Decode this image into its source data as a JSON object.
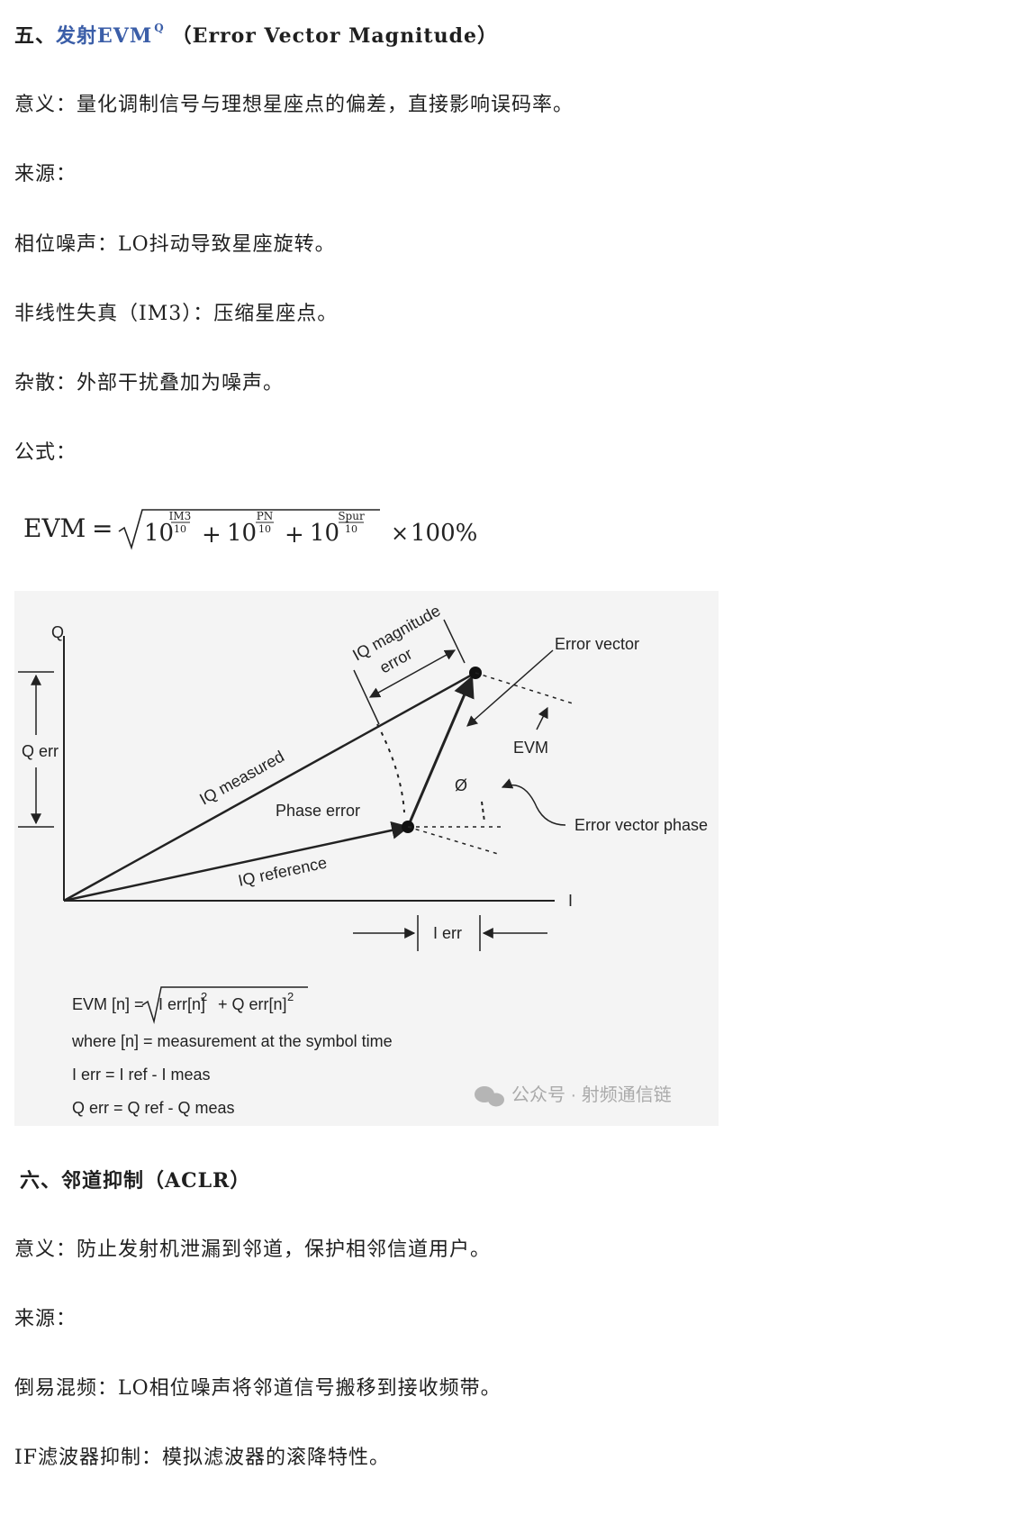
{
  "section5": {
    "heading_prefix": "五、",
    "heading_link": "发射EVM",
    "heading_suffix": "（Error Vector Magnitude）",
    "meaning": "意义：量化调制信号与理想星座点的偏差，直接影响误码率。",
    "source_label": "来源：",
    "source_items": [
      "相位噪声：LO抖动导致星座旋转。",
      "非线性失真（IM3）：压缩星座点。",
      "杂散：外部干扰叠加为噪声。"
    ],
    "formula_label": "公式："
  },
  "formula": {
    "lhs": "EVM",
    "eq": "=",
    "base": "10",
    "exp1_num": "IM3",
    "exp2_num": "PN",
    "exp3_num": "Spur",
    "exp_den": "10",
    "plus": "+",
    "times": "×",
    "pct": "100%"
  },
  "figure": {
    "axis_q": "Q",
    "axis_i": "I",
    "q_err": "Q err",
    "i_err": "I err",
    "iq_measured": "IQ measured",
    "iq_reference": "IQ reference",
    "phase_error": "Phase error",
    "iq_mag_error_1": "IQ magnitude",
    "iq_mag_error_2": "error",
    "error_vector": "Error vector",
    "evm": "EVM",
    "phi": "Ø",
    "error_vector_phase": "Error vector phase",
    "eq_lhs": "EVM [n] =",
    "eq_rhs_a": "I err[n]",
    "eq_rhs_b": "+ Q err[n]",
    "eq_exp": "2",
    "where": "where [n] = measurement at the symbol time",
    "i_err_def": "I err = I ref - I meas",
    "q_err_def": "Q err = Q ref - Q meas",
    "watermark": "公众号 · 射频通信链"
  },
  "section6": {
    "heading": "六、邻道抑制（ACLR）",
    "meaning": "意义：防止发射机泄漏到邻道，保护相邻信道用户。",
    "source_label": "来源：",
    "source_items": [
      "倒易混频：LO相位噪声将邻道信号搬移到接收频带。",
      "IF滤波器抑制：模拟滤波器的滚降特性。"
    ]
  }
}
